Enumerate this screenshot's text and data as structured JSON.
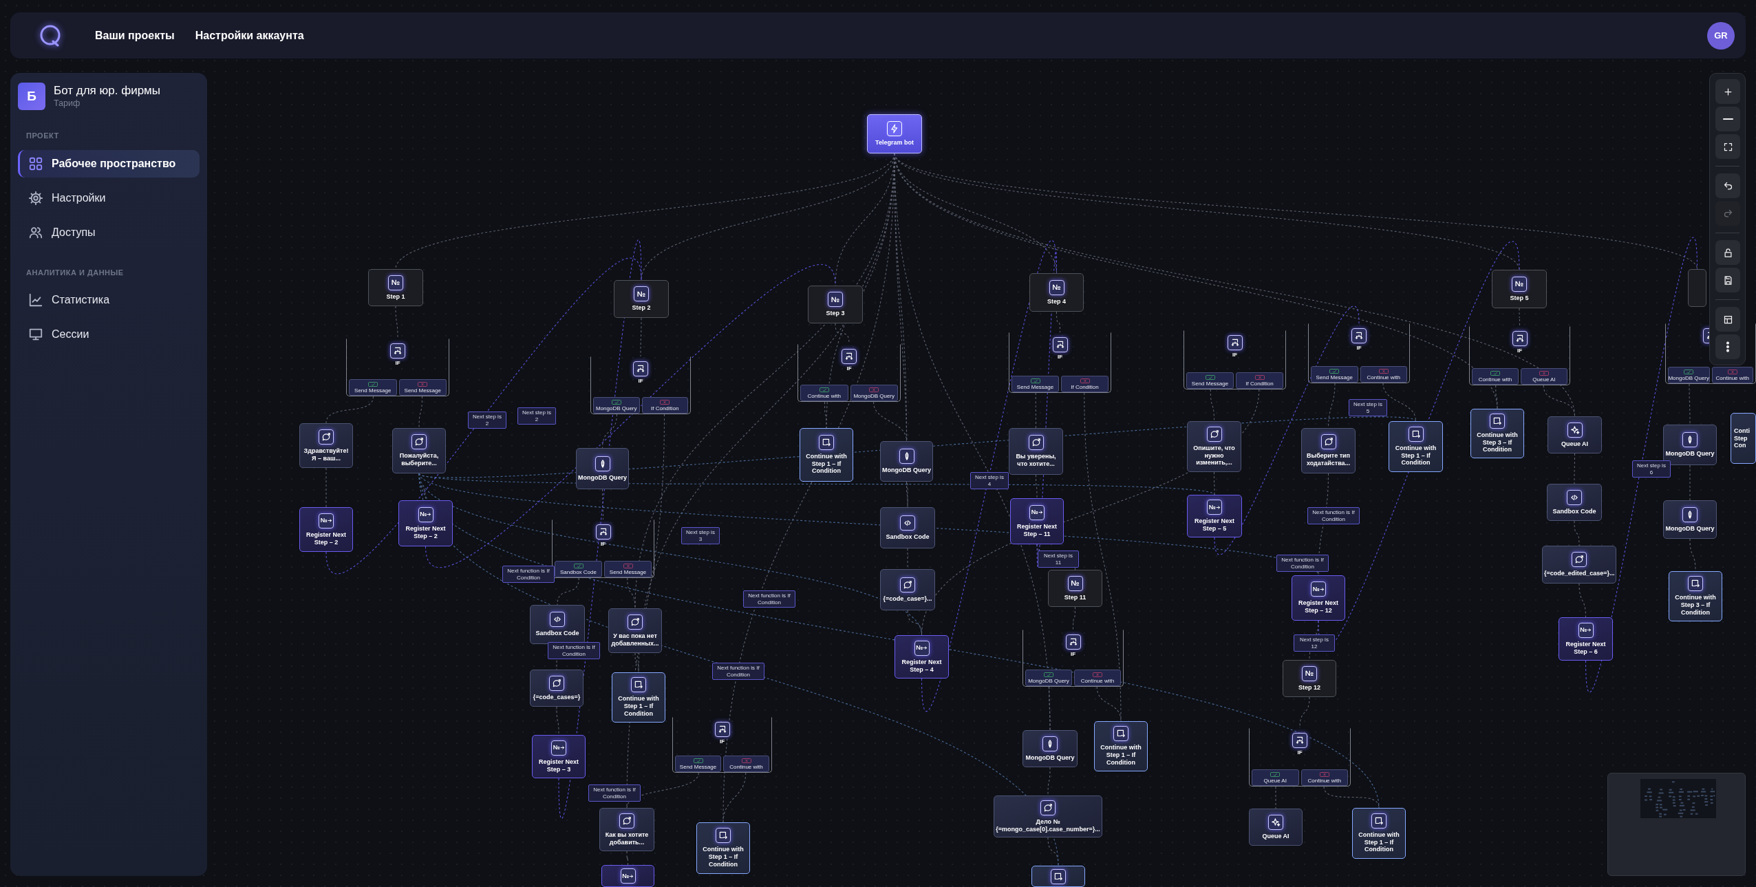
{
  "header": {
    "nav": [
      {
        "label": "Ваши проекты"
      },
      {
        "label": "Настройки аккаунта"
      }
    ],
    "avatar": "GR"
  },
  "sidebar": {
    "project": {
      "initial": "Б",
      "name": "Бот для юр. фирмы",
      "plan": "Тариф"
    },
    "sections": [
      {
        "title": "ПРОЕКТ",
        "items": [
          {
            "label": "Рабочее пространство",
            "selected": true
          },
          {
            "label": "Настройки",
            "selected": false
          },
          {
            "label": "Доступы",
            "selected": false
          }
        ]
      },
      {
        "title": "АНАЛИТИКА И ДАННЫЕ",
        "items": [
          {
            "label": "Статистика",
            "selected": false
          },
          {
            "label": "Сессии",
            "selected": false
          }
        ]
      }
    ]
  },
  "canvas": {
    "nodes": [
      {
        "kind": "trigger",
        "label": "Telegram bot"
      },
      {
        "kind": "step",
        "icon": "№",
        "label": "Step 1"
      },
      {
        "kind": "step",
        "icon": "№",
        "label": "Step 2"
      },
      {
        "kind": "step",
        "icon": "№",
        "label": "Step 3"
      },
      {
        "kind": "step",
        "icon": "№",
        "label": "Step 4"
      },
      {
        "kind": "step",
        "icon": "№",
        "label": "Step 5"
      },
      {
        "kind": "step"
      },
      {
        "kind": "condition",
        "label": "IF",
        "branches": [
          {
            "label": "Send Message",
            "success": true
          },
          {
            "label": "Send Message",
            "success": false
          }
        ]
      },
      {
        "kind": "condition",
        "label": "IF",
        "branches": [
          {
            "label": "MongoDB Query",
            "success": true
          },
          {
            "label": "If Condition",
            "success": false
          }
        ]
      },
      {
        "kind": "condition",
        "label": "IF",
        "branches": [
          {
            "label": "Continue with",
            "success": true
          },
          {
            "label": "MongoDB Query",
            "success": false
          }
        ]
      },
      {
        "kind": "condition",
        "label": "IF",
        "branches": [
          {
            "label": "Send Message",
            "success": true
          },
          {
            "label": "If Condition",
            "success": false
          }
        ]
      },
      {
        "kind": "condition",
        "label": "IF",
        "branches": [
          {
            "label": "Send Message",
            "success": true
          },
          {
            "label": "If Condition",
            "success": false
          }
        ]
      },
      {
        "kind": "condition",
        "label": "IF",
        "branches": [
          {
            "label": "Send Message",
            "success": true
          },
          {
            "label": "Continue with",
            "success": false
          }
        ]
      },
      {
        "kind": "condition",
        "label": "IF",
        "branches": [
          {
            "label": "Continue with",
            "success": true
          },
          {
            "label": "Queue AI",
            "success": false
          }
        ]
      },
      {
        "kind": "condition",
        "branches": [
          {
            "label": "MongoDB Query",
            "success": true
          },
          {
            "label": "Continue with",
            "success": false
          }
        ]
      },
      {
        "kind": "message",
        "label": "Здравствуйте! Я – ваш..."
      },
      {
        "kind": "message",
        "label": "Пожалуйста, выберите..."
      },
      {
        "kind": "mongo",
        "label": "MongoDB Query"
      },
      {
        "kind": "continue",
        "label": "Continue with Step 1 – If Condition"
      },
      {
        "kind": "mongo",
        "label": "MongoDB Query"
      },
      {
        "kind": "message",
        "label": "Вы уверены, что хотите..."
      },
      {
        "kind": "message",
        "label": "Опишите, что нужно изменить,..."
      },
      {
        "kind": "message",
        "label": "Выберите тип ходатайства..."
      },
      {
        "kind": "continue",
        "label": "Continue with Step 1 – If Condition"
      },
      {
        "kind": "continue",
        "label": "Continue with Step 3 – If Condition"
      },
      {
        "kind": "queue",
        "label": "Queue AI"
      },
      {
        "kind": "mongo",
        "label": "MongoDB Query"
      },
      {
        "kind": "continue",
        "label": "Conti\nStep\nCon"
      },
      {
        "kind": "register",
        "icon": "№",
        "label": "Register Next Step – 2"
      },
      {
        "kind": "register",
        "icon": "№",
        "label": "Register Next Step – 2"
      },
      {
        "kind": "condition",
        "label": "IF",
        "branches": [
          {
            "label": "Sandbox Code",
            "success": true
          },
          {
            "label": "Send Message",
            "success": false
          }
        ]
      },
      {
        "kind": "sandbox",
        "label": "Sandbox Code"
      },
      {
        "kind": "register",
        "icon": "№",
        "label": "Register Next Step – 11"
      },
      {
        "kind": "register",
        "icon": "№",
        "label": "Register Next Step – 5"
      },
      {
        "kind": "sandbox",
        "label": "Sandbox Code"
      },
      {
        "kind": "mongo",
        "label": "MongoDB Query"
      },
      {
        "kind": "message",
        "label": "{=code_case=}..."
      },
      {
        "kind": "step",
        "icon": "№",
        "label": "Step 11"
      },
      {
        "kind": "register",
        "icon": "№",
        "label": "Register Next Step – 12"
      },
      {
        "kind": "message",
        "label": "{=code_edited_case=}..."
      },
      {
        "kind": "continue",
        "label": "Continue with Step 3 – If Condition"
      },
      {
        "kind": "sandbox",
        "label": "Sandbox Code"
      },
      {
        "kind": "message",
        "label": "У вас пока нет добавленных..."
      },
      {
        "kind": "register",
        "icon": "№",
        "label": "Register Next Step – 4"
      },
      {
        "kind": "condition",
        "label": "IF",
        "branches": [
          {
            "label": "MongoDB Query",
            "success": true
          },
          {
            "label": "Continue with",
            "success": false
          }
        ]
      },
      {
        "kind": "register",
        "icon": "№",
        "label": "Register Next Step – 6"
      },
      {
        "kind": "message",
        "label": "{=code_cases=}"
      },
      {
        "kind": "continue",
        "label": "Continue with Step 1 – If Condition"
      },
      {
        "kind": "step",
        "icon": "№",
        "label": "Step 12"
      },
      {
        "kind": "register",
        "icon": "№",
        "label": "Register Next Step – 3"
      },
      {
        "kind": "condition",
        "label": "IF",
        "branches": [
          {
            "label": "Send Message",
            "success": true
          },
          {
            "label": "Continue with",
            "success": false
          }
        ]
      },
      {
        "kind": "mongo",
        "label": "MongoDB Query"
      },
      {
        "kind": "continue",
        "label": "Continue with Step 1 – If Condition"
      },
      {
        "kind": "condition",
        "label": "IF",
        "branches": [
          {
            "label": "Queue AI",
            "success": true
          },
          {
            "label": "Continue with",
            "success": false
          }
        ]
      },
      {
        "kind": "message",
        "label": "Как вы хотите добавить..."
      },
      {
        "kind": "continue",
        "label": "Continue with Step 1 – If Condition"
      },
      {
        "kind": "message",
        "label": "Дело № {=mongo_case[0].case_number=}..."
      },
      {
        "kind": "queue",
        "label": "Queue AI"
      },
      {
        "kind": "continue",
        "label": "Continue with Step 1 – If Condition"
      },
      {
        "kind": "register",
        "icon": "№"
      },
      {
        "kind": "continue"
      }
    ],
    "edge_labels": [
      {
        "label": "Next step is 2"
      },
      {
        "label": "Next step is 2"
      },
      {
        "label": "Next step is 3"
      },
      {
        "label": "Next function is If Condition"
      },
      {
        "label": "Next function is If Condition"
      },
      {
        "label": "Next function is If Condition"
      },
      {
        "label": "Next function is If Condition"
      },
      {
        "label": "Next function is If Condition"
      },
      {
        "label": "Next step is 4"
      },
      {
        "label": "Next step is 11"
      },
      {
        "label": "Next step is 5"
      },
      {
        "label": "Next function is If Condition"
      },
      {
        "label": "Next function is If Condition"
      },
      {
        "label": "Next step is 12"
      },
      {
        "label": "Next step is 6"
      }
    ]
  },
  "toolbar": {
    "groups": [
      {
        "buttons": [
          {
            "kind": "zoom-in",
            "disabled": false
          },
          {
            "kind": "zoom-out",
            "disabled": false
          },
          {
            "kind": "fit",
            "disabled": false
          }
        ]
      },
      {
        "buttons": [
          {
            "kind": "undo",
            "disabled": false
          },
          {
            "kind": "redo",
            "disabled": true
          }
        ]
      },
      {
        "buttons": [
          {
            "kind": "lock",
            "disabled": false
          },
          {
            "kind": "save",
            "disabled": false
          }
        ]
      },
      {
        "buttons": [
          {
            "kind": "layout",
            "disabled": false
          },
          {
            "kind": "more",
            "disabled": false
          }
        ]
      }
    ]
  }
}
